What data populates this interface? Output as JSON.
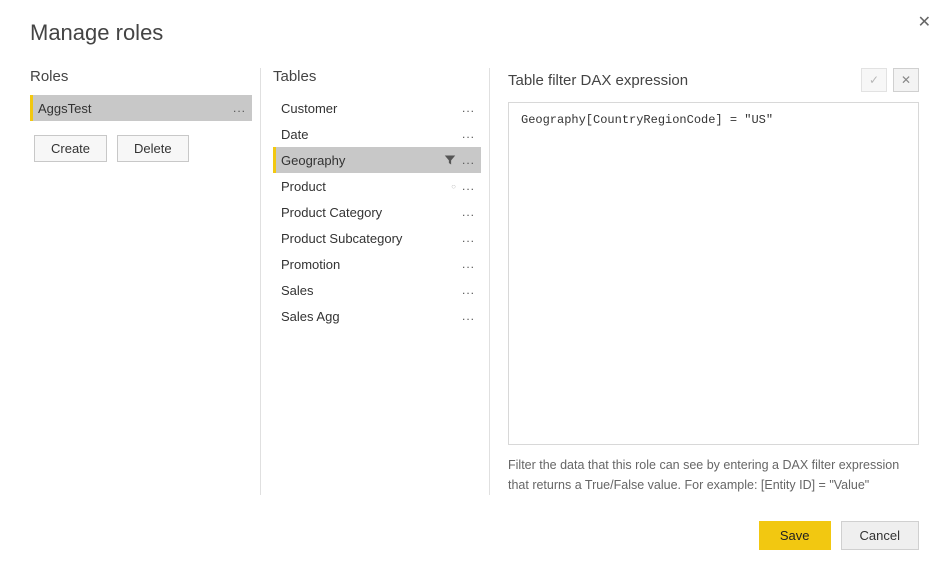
{
  "dialog": {
    "title": "Manage roles"
  },
  "roles": {
    "header": "Roles",
    "items": [
      {
        "label": "AggsTest",
        "selected": true
      }
    ],
    "create_label": "Create",
    "delete_label": "Delete"
  },
  "tables": {
    "header": "Tables",
    "items": [
      {
        "label": "Customer",
        "selected": false,
        "has_filter": false,
        "has_dot": false
      },
      {
        "label": "Date",
        "selected": false,
        "has_filter": false,
        "has_dot": false
      },
      {
        "label": "Geography",
        "selected": true,
        "has_filter": true,
        "has_dot": false
      },
      {
        "label": "Product",
        "selected": false,
        "has_filter": false,
        "has_dot": true
      },
      {
        "label": "Product Category",
        "selected": false,
        "has_filter": false,
        "has_dot": false
      },
      {
        "label": "Product Subcategory",
        "selected": false,
        "has_filter": false,
        "has_dot": false
      },
      {
        "label": "Promotion",
        "selected": false,
        "has_filter": false,
        "has_dot": false
      },
      {
        "label": "Sales",
        "selected": false,
        "has_filter": false,
        "has_dot": false
      },
      {
        "label": "Sales Agg",
        "selected": false,
        "has_filter": false,
        "has_dot": false
      }
    ]
  },
  "dax": {
    "header": "Table filter DAX expression",
    "expression": "Geography[CountryRegionCode] = \"US\"",
    "hint": "Filter the data that this role can see by entering a DAX filter expression that returns a True/False value. For example: [Entity ID] = \"Value\"",
    "confirm_glyph": "✓",
    "cancel_glyph": "✕"
  },
  "footer": {
    "save_label": "Save",
    "cancel_label": "Cancel"
  },
  "close_glyph": "✕"
}
